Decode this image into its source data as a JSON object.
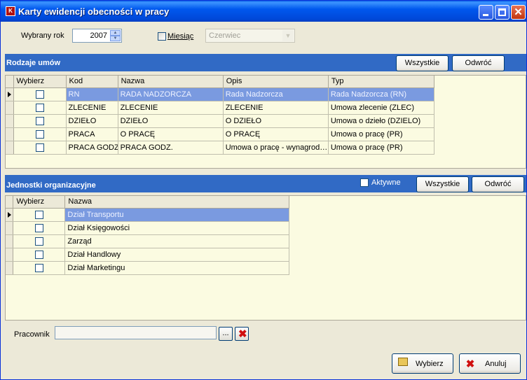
{
  "window": {
    "title": "Karty ewidencji obecności w pracy",
    "icon": "app-icon"
  },
  "filters": {
    "year_label": "Wybrany rok",
    "year_value": "2007",
    "month_label": "Miesiąc",
    "month_checked": false,
    "month_value": "Czerwiec"
  },
  "contracts": {
    "section_title": "Rodzaje umów",
    "all_button": "Wszystkie",
    "invert_button": "Odwróć",
    "columns": [
      "Wybierz",
      "Kod",
      "Nazwa",
      "Opis",
      "Typ"
    ],
    "rows": [
      {
        "kod": "RN",
        "nazwa": "RADA NADZORCZA",
        "opis": "Rada Nadzorcza",
        "typ": "Rada Nadzorcza (RN)"
      },
      {
        "kod": "ZLECENIE",
        "nazwa": "ZLECENIE",
        "opis": "ZLECENIE",
        "typ": "Umowa zlecenie (ZLEC)"
      },
      {
        "kod": "DZIEŁO",
        "nazwa": "DZIEŁO",
        "opis": "O DZIEŁO",
        "typ": "Umowa o dzieło (DZIELO)"
      },
      {
        "kod": "PRACA",
        "nazwa": "O PRACĘ",
        "opis": "O PRACĘ",
        "typ": "Umowa o pracę (PR)"
      },
      {
        "kod": "PRACA GODZ",
        "nazwa": "PRACA GODZ.",
        "opis": "Umowa o pracę - wynagrod…",
        "typ": "Umowa o pracę (PR)"
      }
    ]
  },
  "units": {
    "section_title": "Jednostki organizacyjne",
    "active_label": "Aktywne",
    "all_button": "Wszystkie",
    "invert_button": "Odwróć",
    "columns": [
      "Wybierz",
      "Nazwa"
    ],
    "rows": [
      {
        "nazwa": "Dział Transportu"
      },
      {
        "nazwa": "Dział Księgowości"
      },
      {
        "nazwa": "Zarząd"
      },
      {
        "nazwa": "Dział Handlowy"
      },
      {
        "nazwa": "Dział Marketingu"
      }
    ]
  },
  "employee": {
    "label": "Pracownik",
    "value": "",
    "browse_label": "..."
  },
  "actions": {
    "select_label": "Wybierz",
    "cancel_label": "Anuluj"
  },
  "colors": {
    "titlebar": "#0058ee",
    "section_bar": "#316ac5",
    "selected_row": "#7a9ae0",
    "grid_bg": "#fbfbe1"
  }
}
